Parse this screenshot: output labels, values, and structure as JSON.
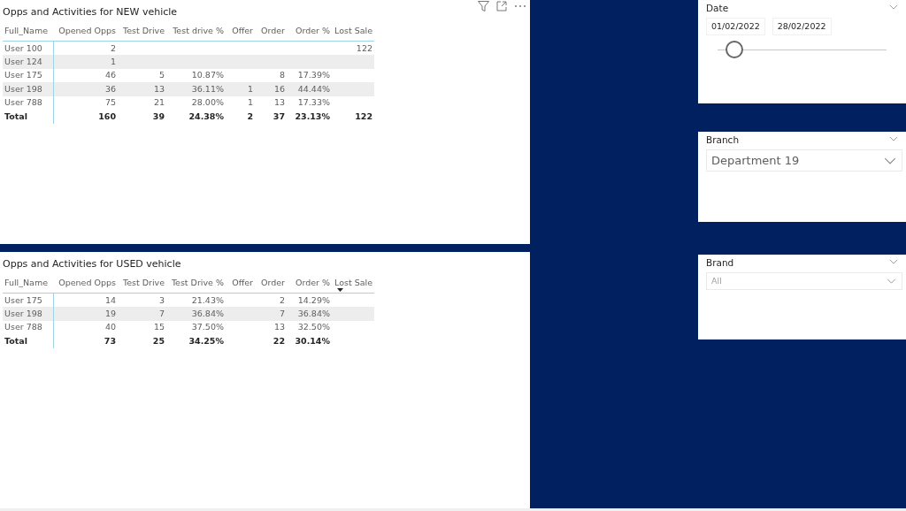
{
  "visuals": [
    {
      "title": "Opps and Activities for NEW vehicle",
      "toolbar": true,
      "columns": [
        {
          "label": "Full_Name",
          "sorted": false
        },
        {
          "label": "Opened Opps",
          "sorted": false
        },
        {
          "label": "Test Drive",
          "sorted": false
        },
        {
          "label": "Test drive %",
          "sorted": false
        },
        {
          "label": "Offer",
          "sorted": false
        },
        {
          "label": "Order",
          "sorted": false
        },
        {
          "label": "Order %",
          "sorted": false
        },
        {
          "label": "Lost Sale",
          "sorted": false
        }
      ],
      "rows": [
        {
          "full_name": "User 100",
          "opened_opps": "2",
          "lost_sale": "122"
        },
        {
          "full_name": "User 124",
          "opened_opps": "1"
        },
        {
          "full_name": "User 175",
          "opened_opps": "46",
          "test_drive": "5",
          "test_drive_pct": "10.87%",
          "order": "8",
          "order_pct": "17.39%"
        },
        {
          "full_name": "User 198",
          "opened_opps": "36",
          "test_drive": "13",
          "test_drive_pct": "36.11%",
          "offer": "1",
          "order": "16",
          "order_pct": "44.44%"
        },
        {
          "full_name": "User 788",
          "opened_opps": "75",
          "test_drive": "21",
          "test_drive_pct": "28.00%",
          "offer": "1",
          "order": "13",
          "order_pct": "17.33%"
        }
      ],
      "total": {
        "full_name": "Total",
        "opened_opps": "160",
        "test_drive": "39",
        "test_drive_pct": "24.38%",
        "offer": "2",
        "order": "37",
        "order_pct": "23.13%",
        "lost_sale": "122"
      }
    },
    {
      "title": "Opps and Activities for USED vehicle",
      "toolbar": false,
      "columns": [
        {
          "label": "Full_Name",
          "sorted": false
        },
        {
          "label": "Opened Opps",
          "sorted": false
        },
        {
          "label": "Test Drive",
          "sorted": false
        },
        {
          "label": "Test Drive %",
          "sorted": false
        },
        {
          "label": "Offer",
          "sorted": false
        },
        {
          "label": "Order",
          "sorted": false
        },
        {
          "label": "Order %",
          "sorted": false
        },
        {
          "label": "Lost Sale",
          "sorted": true
        }
      ],
      "rows": [
        {
          "full_name": "User 175",
          "opened_opps": "14",
          "test_drive": "3",
          "test_drive_pct": "21.43%",
          "order": "2",
          "order_pct": "14.29%"
        },
        {
          "full_name": "User 198",
          "opened_opps": "19",
          "test_drive": "7",
          "test_drive_pct": "36.84%",
          "order": "7",
          "order_pct": "36.84%"
        },
        {
          "full_name": "User 788",
          "opened_opps": "40",
          "test_drive": "15",
          "test_drive_pct": "37.50%",
          "order": "13",
          "order_pct": "32.50%"
        }
      ],
      "total": {
        "full_name": "Total",
        "opened_opps": "73",
        "test_drive": "25",
        "test_drive_pct": "34.25%",
        "order": "22",
        "order_pct": "30.14%"
      }
    }
  ],
  "slicers": [
    {
      "kind": "date",
      "title": "Date",
      "from": "01/02/2022",
      "to": "28/02/2022",
      "level": 0.1
    },
    {
      "kind": "dropdown",
      "title": "Branch",
      "value": "Department 19",
      "large": true
    },
    {
      "kind": "dropdown",
      "title": "Brand",
      "value": "All",
      "large": false
    }
  ]
}
